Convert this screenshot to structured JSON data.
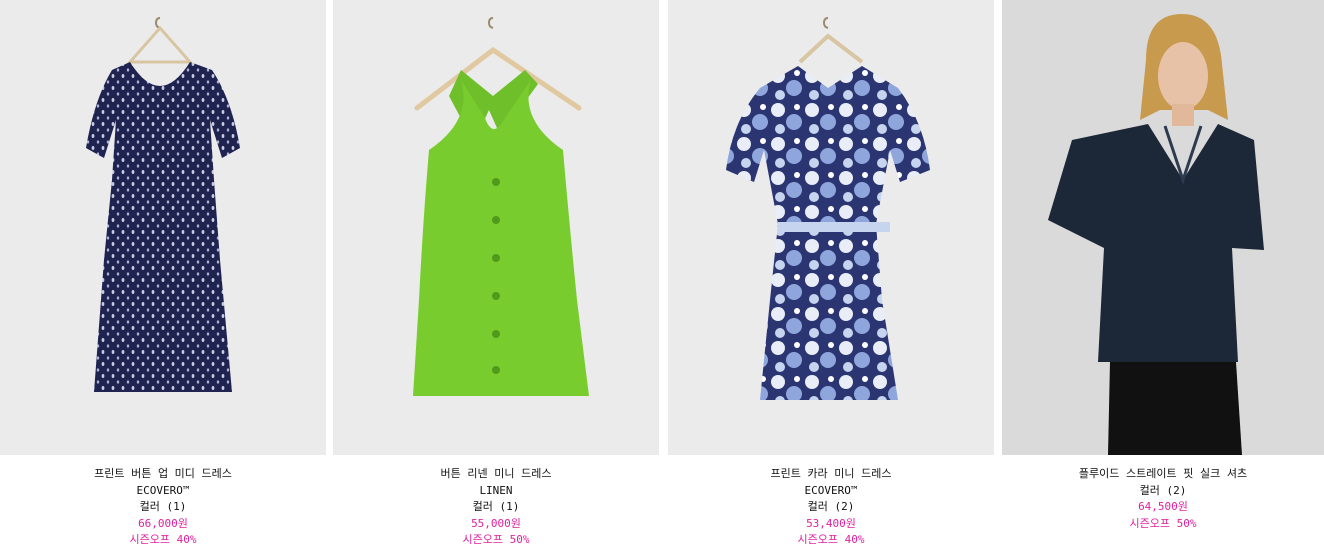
{
  "colors": {
    "accent": "#e0219e",
    "text": "#111111",
    "image_bg": "#ebebeb"
  },
  "products": [
    {
      "name": "프린트 버튼 업 미디 드레스",
      "material": "ECOVERO™",
      "colors": "컬러 (1)",
      "price": "66,000원",
      "sale": "시즌오프 40%"
    },
    {
      "name": "버튼 리넨 미니 드레스",
      "material": "LINEN",
      "colors": "컬러 (1)",
      "price": "55,000원",
      "sale": "시즌오프 50%"
    },
    {
      "name": "프린트 카라 미니 드레스",
      "material": "ECOVERO™",
      "colors": "컬러 (2)",
      "price": "53,400원",
      "sale": "시즌오프 40%"
    },
    {
      "name": "플루이드 스트레이트 핏 실크 셔츠",
      "colors": "컬러 (2)",
      "price": "64,500원",
      "sale": "시즌오프 50%"
    }
  ]
}
